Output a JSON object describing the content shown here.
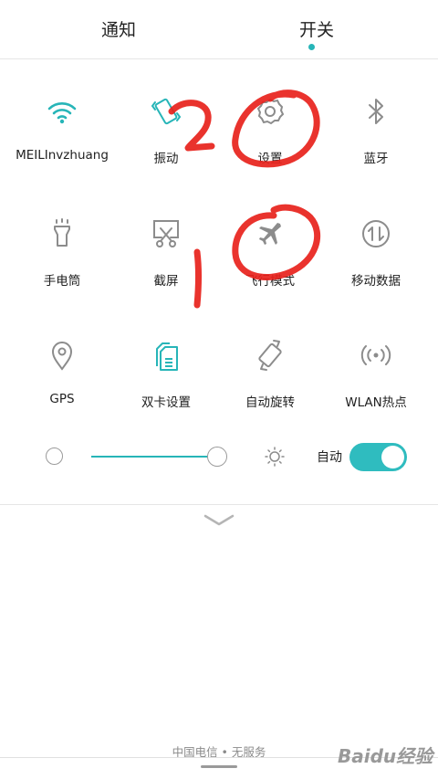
{
  "tabs": {
    "notifications": "通知",
    "switches": "开关",
    "active": "switches"
  },
  "tiles": [
    {
      "label": "MEILInvzhuang",
      "icon": "wifi-icon",
      "active": true
    },
    {
      "label": "振动",
      "icon": "vibrate-icon",
      "active": true
    },
    {
      "label": "设置",
      "icon": "settings-icon",
      "active": false
    },
    {
      "label": "蓝牙",
      "icon": "bluetooth-icon",
      "active": false
    },
    {
      "label": "手电筒",
      "icon": "flashlight-icon",
      "active": false
    },
    {
      "label": "截屏",
      "icon": "screenshot-icon",
      "active": false
    },
    {
      "label": "飞行模式",
      "icon": "airplane-icon",
      "active": false
    },
    {
      "label": "移动数据",
      "icon": "mobile-data-icon",
      "active": false
    },
    {
      "label": "GPS",
      "icon": "gps-icon",
      "active": false
    },
    {
      "label": "双卡设置",
      "icon": "dual-sim-icon",
      "active": true
    },
    {
      "label": "自动旋转",
      "icon": "auto-rotate-icon",
      "active": false
    },
    {
      "label": "WLAN热点",
      "icon": "hotspot-icon",
      "active": false
    }
  ],
  "brightness": {
    "level": 0.93,
    "auto_label": "自动",
    "auto_enabled": true
  },
  "carrier": "中国电信 • 无服务",
  "watermark": "Baidu经验",
  "annotations": [
    "2",
    "1"
  ],
  "colors": {
    "accent": "#27b5b8",
    "icon_gray": "#8c8c8c",
    "marker_red": "#e8221c"
  }
}
